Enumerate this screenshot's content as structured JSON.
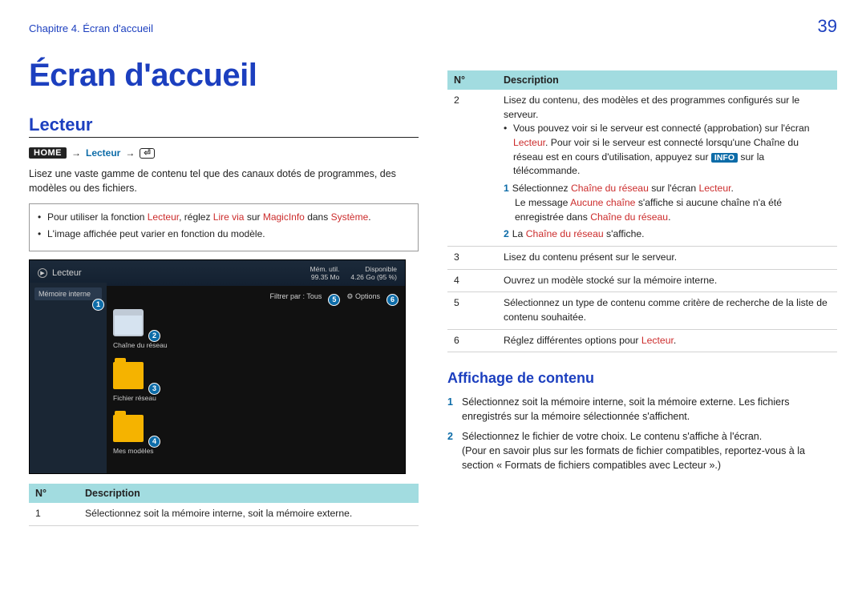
{
  "header": {
    "chapter": "Chapitre 4. Écran d'accueil",
    "page_number": "39"
  },
  "title": "Écran d'accueil",
  "section_title": "Lecteur",
  "breadcrumb": {
    "home": "HOME",
    "item": "Lecteur"
  },
  "intro_para": "Lisez une vaste gamme de contenu tel que des canaux dotés de programmes, des modèles ou des fichiers.",
  "notes": {
    "line1_pre": "Pour utiliser la fonction ",
    "line1_lecteur": "Lecteur",
    "line1_mid": ", réglez ",
    "line1_lirevia": "Lire via",
    "line1_sur": " sur ",
    "line1_magicinfo": "MagicInfo",
    "line1_dans": " dans ",
    "line1_systeme": "Système",
    "line1_end": ".",
    "line2": "L'image affichée peut varier en fonction du modèle."
  },
  "screenshot": {
    "title": "Lecteur",
    "status_left": "Mém. util.",
    "status_left_val": "99.35 Mo",
    "status_right": "Disponible",
    "status_right_val": "4.26 Go (95 %)",
    "sidebar_item": "Mémoire interne",
    "filter_label": "Filtrer par : Tous",
    "options_label": "Options",
    "grid_item2": "Chaîne du réseau",
    "grid_item3": "Fichier réseau",
    "grid_item4": "Mes modèles"
  },
  "left_table": {
    "h_no": "N°",
    "h_desc": "Description",
    "r1_no": "1",
    "r1_desc": "Sélectionnez soit la mémoire interne, soit la mémoire externe."
  },
  "right_table": {
    "h_no": "N°",
    "h_desc": "Description",
    "r2_no": "2",
    "r2_main": "Lisez du contenu, des modèles et des programmes configurés sur le serveur.",
    "r2_b1_pre": "Vous pouvez voir si le serveur est connecté (approbation) sur l'écran ",
    "r2_b1_lecteur": "Lecteur",
    "r2_b1_mid": ". Pour voir si le serveur est connecté lorsqu'une Chaîne du réseau est en cours d'utilisation, appuyez sur ",
    "r2_b1_info": "INFO",
    "r2_b1_end": " sur la télécommande.",
    "r2_s1_num": "1",
    "r2_s1_pre": "Sélectionnez ",
    "r2_s1_chaine": "Chaîne du réseau",
    "r2_s1_mid": " sur l'écran ",
    "r2_s1_lect": "Lecteur",
    "r2_s1_end": ".",
    "r2_s1_msg_pre": "Le message ",
    "r2_s1_aucune": "Aucune chaîne",
    "r2_s1_msg_mid": " s'affiche si aucune chaîne n'a été enregistrée dans ",
    "r2_s1_chaine2": "Chaîne du réseau",
    "r2_s1_msg_end": ".",
    "r2_s2_num": "2",
    "r2_s2_pre": "La ",
    "r2_s2_chaine": "Chaîne du réseau",
    "r2_s2_end": " s'affiche.",
    "r3_no": "3",
    "r3_desc": "Lisez du contenu présent sur le serveur.",
    "r4_no": "4",
    "r4_desc": "Ouvrez un modèle stocké sur la mémoire interne.",
    "r5_no": "5",
    "r5_desc": "Sélectionnez un type de contenu comme critère de recherche de la liste de contenu souhaitée.",
    "r6_no": "6",
    "r6_pre": "Réglez différentes options pour ",
    "r6_lecteur": "Lecteur",
    "r6_end": "."
  },
  "subsection_title": "Affichage de contenu",
  "steps": {
    "s1_num": "1",
    "s1_text": "Sélectionnez soit la mémoire interne, soit la mémoire externe. Les fichiers enregistrés sur la mémoire sélectionnée s'affichent.",
    "s2_num": "2",
    "s2_text": "Sélectionnez le fichier de votre choix. Le contenu s'affiche à l'écran.",
    "s2_sub": "(Pour en savoir plus sur les formats de fichier compatibles, reportez-vous à la section « Formats de fichiers compatibles avec Lecteur ».)"
  }
}
